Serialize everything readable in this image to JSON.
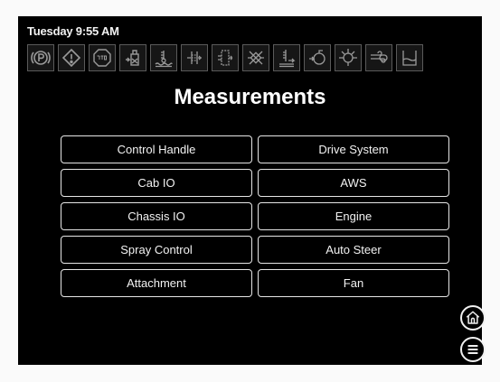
{
  "status": {
    "time_label": "Tuesday 9:55 AM"
  },
  "warning_icons": [
    {
      "name": "parking-brake-icon"
    },
    {
      "name": "warning-triangle-icon"
    },
    {
      "name": "stop-icon"
    },
    {
      "name": "fuel-filter-icon"
    },
    {
      "name": "coolant-level-icon"
    },
    {
      "name": "hydraulic-filter-icon"
    },
    {
      "name": "hydraulic-pressure-icon"
    },
    {
      "name": "filter-bypass-icon"
    },
    {
      "name": "fluid-level-icon"
    },
    {
      "name": "oil-filter-icon"
    },
    {
      "name": "engine-oil-pressure-icon"
    },
    {
      "name": "air-filter-icon"
    },
    {
      "name": "tank-level-icon"
    }
  ],
  "page": {
    "title": "Measurements"
  },
  "menu": {
    "items": [
      {
        "label": "Control Handle"
      },
      {
        "label": "Drive System"
      },
      {
        "label": "Cab IO"
      },
      {
        "label": "AWS"
      },
      {
        "label": "Chassis IO"
      },
      {
        "label": "Engine"
      },
      {
        "label": "Spray Control"
      },
      {
        "label": "Auto Steer"
      },
      {
        "label": "Attachment"
      },
      {
        "label": "Fan"
      }
    ]
  },
  "colors": {
    "screen_background": "#000000",
    "button_border": "#e6e6e6",
    "icon_border": "#5a5a5a",
    "text": "#ffffff"
  }
}
